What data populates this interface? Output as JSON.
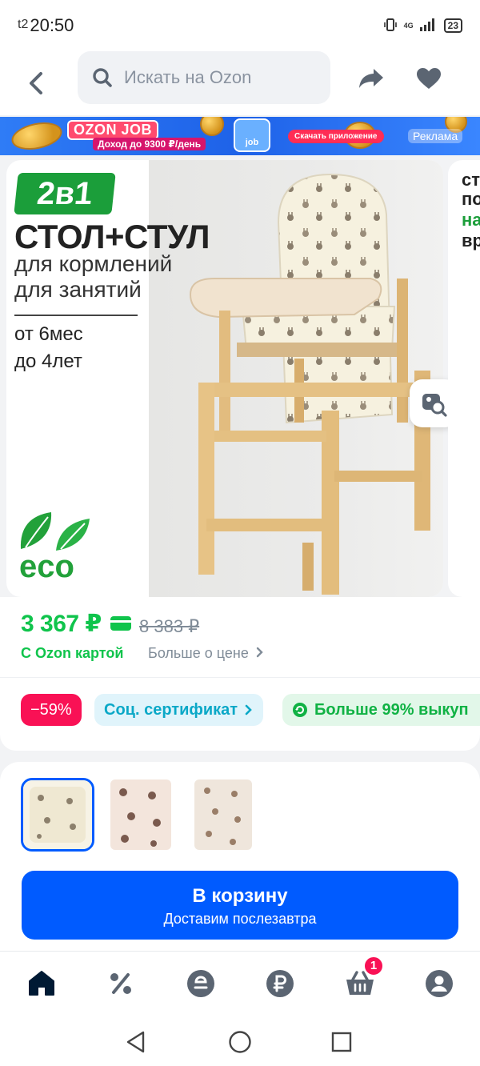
{
  "status_bar": {
    "carrier": "t2",
    "time": "20:50",
    "signal": "4G",
    "battery": "23"
  },
  "header": {
    "search_placeholder": "Искать на Ozon",
    "icons": [
      "back-icon",
      "search-icon",
      "share-icon",
      "heart-icon"
    ]
  },
  "ad_banner": {
    "title": "OZON JOB",
    "subtitle": "Доход до 9300 ₽/день",
    "phone_label": "job",
    "cta": "Скачать приложение",
    "label": "Реклама"
  },
  "gallery": {
    "badge": "2в1",
    "title": "СТОЛ+СТУЛ",
    "line1": "для кормлений",
    "line2": "для занятий",
    "age_from": "от  6мес",
    "age_to": "до 4лет",
    "eco_label": "eco",
    "next_card_lines": [
      "ст",
      "по",
      "на",
      "вр"
    ]
  },
  "price": {
    "current": "3 367 ₽",
    "old": "8 383 ₽",
    "card_note": "С Ozon картой",
    "more": "Больше о цене"
  },
  "chips": {
    "discount": "−59%",
    "certificate": "Соц. сертификат",
    "buyout": "Больше 99% выкуп"
  },
  "purchase": {
    "thumbnails": [
      "thumb-cream-bunnies",
      "thumb-bears",
      "thumb-beige-animals"
    ],
    "button_label": "В корзину",
    "button_sub": "Доставим послезавтра"
  },
  "bottom_nav": {
    "items": [
      "home-icon",
      "percent-icon",
      "ozon-fresh-icon",
      "ruble-icon",
      "cart-icon",
      "profile-icon"
    ],
    "cart_badge": "1"
  },
  "colors": {
    "brand_blue": "#005bff",
    "price_green": "#10c44c",
    "discount_pink": "#f91155"
  }
}
